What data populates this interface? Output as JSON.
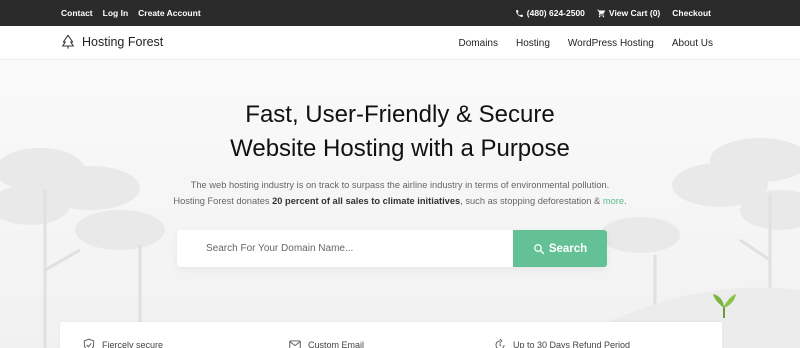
{
  "topbar": {
    "links": [
      "Contact",
      "Log In",
      "Create Account"
    ],
    "phone": "(480) 624-2500",
    "cart": "View Cart (0)",
    "checkout": "Checkout"
  },
  "brand": {
    "name": "Hosting Forest"
  },
  "nav": {
    "items": [
      "Domains",
      "Hosting",
      "WordPress Hosting",
      "About Us"
    ]
  },
  "hero": {
    "headline_line1": "Fast, User-Friendly & Secure",
    "headline_line2": "Website Hosting with a Purpose",
    "sub_line1": "The web hosting industry is on track to surpass the airline industry in terms of environmental pollution.",
    "sub_line2_pre": "Hosting Forest donates ",
    "sub_line2_bold": "20 percent of all sales to climate initiatives",
    "sub_line2_post": ", such as stopping deforestation & ",
    "sub_line2_link": "more",
    "sub_line2_end": "."
  },
  "search": {
    "placeholder": "Search For Your Domain Name...",
    "button_label": "Search"
  },
  "features": [
    "Fiercely secure",
    "Custom Email",
    "Up to 30 Days Refund Period"
  ],
  "colors": {
    "accent": "#64c196",
    "topbar": "#2b2b2b",
    "link": "#5bb98c"
  }
}
